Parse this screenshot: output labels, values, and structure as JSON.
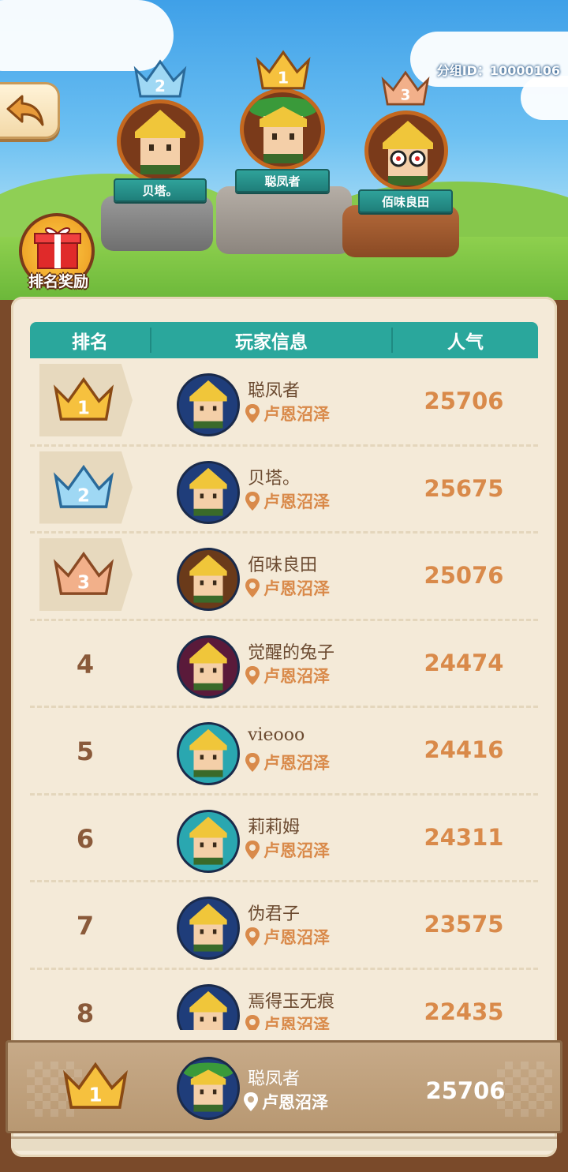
{
  "group_id": "分组ID：10000106",
  "reward_label": "排名奖励",
  "podium": [
    {
      "rank": "2",
      "name": "贝塔。"
    },
    {
      "rank": "1",
      "name": "聪凤者"
    },
    {
      "rank": "3",
      "name": "佰味良田"
    }
  ],
  "columns": {
    "rank": "排名",
    "info": "玩家信息",
    "popularity": "人气"
  },
  "rows": [
    {
      "rank": "1",
      "name": "聪凤者",
      "location": "卢恩沼泽",
      "score": "25706",
      "avatar_bg": "#1f3d7a"
    },
    {
      "rank": "2",
      "name": "贝塔。",
      "location": "卢恩沼泽",
      "score": "25675",
      "avatar_bg": "#1f3d7a"
    },
    {
      "rank": "3",
      "name": "佰味良田",
      "location": "卢恩沼泽",
      "score": "25076",
      "avatar_bg": "#6a3a1a"
    },
    {
      "rank": "4",
      "name": "觉醒的兔子",
      "location": "卢恩沼泽",
      "score": "24474",
      "avatar_bg": "#5a1a3a"
    },
    {
      "rank": "5",
      "name": "vieooo",
      "location": "卢恩沼泽",
      "score": "24416",
      "avatar_bg": "#2aa7b0"
    },
    {
      "rank": "6",
      "name": "莉莉姆",
      "location": "卢恩沼泽",
      "score": "24311",
      "avatar_bg": "#2aa7b0"
    },
    {
      "rank": "7",
      "name": "伪君子",
      "location": "卢恩沼泽",
      "score": "23575",
      "avatar_bg": "#1f3d7a"
    },
    {
      "rank": "8",
      "name": "焉得玉无痕",
      "location": "卢恩沼泽",
      "score": "22435",
      "avatar_bg": "#1f3d7a"
    }
  ],
  "my_rank": {
    "rank": "1",
    "name": "聪凤者",
    "location": "卢恩沼泽",
    "score": "25706"
  },
  "colors": {
    "header": "#2aa79c",
    "score": "#d98a4a",
    "gold": "#f4b43a",
    "silver": "#7cc6ea",
    "bronze": "#e9a27a"
  },
  "icons": {
    "back": "back-arrow-icon",
    "location": "location-pin-icon",
    "gift": "gift-box-icon",
    "crown": "crown-icon"
  }
}
